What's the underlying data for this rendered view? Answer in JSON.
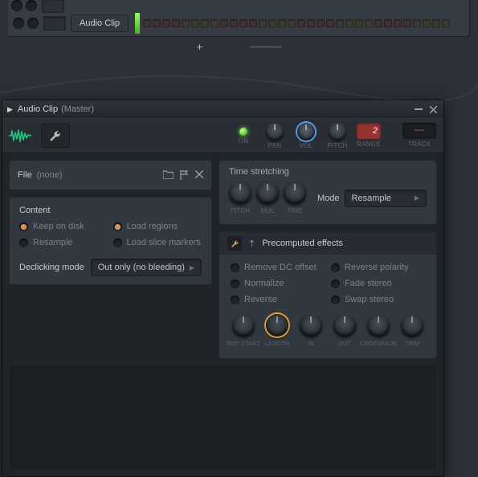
{
  "top": {
    "clip_label": "Audio Clip",
    "add_icon": "+"
  },
  "dialog": {
    "title": "Audio Clip",
    "title_suffix": "(Master)",
    "toolbar": {
      "on_label": "ON",
      "pan_label": "PAN",
      "vol_label": "VOL",
      "pitch_label": "PITCH",
      "range_label": "RANGE",
      "range_value": "2",
      "track_label": "TRACK",
      "track_value": "----"
    },
    "file": {
      "label": "File",
      "value": "(none)"
    },
    "content": {
      "heading": "Content",
      "options": {
        "keep_on_disk": "Keep on disk",
        "load_regions": "Load regions",
        "resample": "Resample",
        "load_slice_markers": "Load slice markers"
      },
      "selected_option": "keep_on_disk",
      "declicking_label": "Declicking mode",
      "declicking_value": "Out only (no bleeding)"
    },
    "stretch": {
      "heading": "Time stretching",
      "knobs": {
        "pitch": "PITCH",
        "mul": "MUL",
        "time": "TIME"
      },
      "mode_label": "Mode",
      "mode_value": "Resample"
    },
    "fx": {
      "heading": "Precomputed effects",
      "options": {
        "remove_dc": "Remove DC offset",
        "reverse_polarity": "Reverse polarity",
        "normalize": "Normalize",
        "fade_stereo": "Fade stereo",
        "reverse": "Reverse",
        "swap_stereo": "Swap stereo"
      },
      "knobs": {
        "smp_start": "SMP START",
        "length": "LENGTH",
        "in": "IN",
        "out": "OUT",
        "crossfade": "CROSSFADE",
        "trim": "TRIM"
      },
      "highlighted_knob": "length"
    },
    "colors": {
      "accent_green": "#1cc97b",
      "accent_orange": "#e59a2e",
      "accent_blue": "#4ea0e8",
      "range_red": "#95322f"
    }
  }
}
